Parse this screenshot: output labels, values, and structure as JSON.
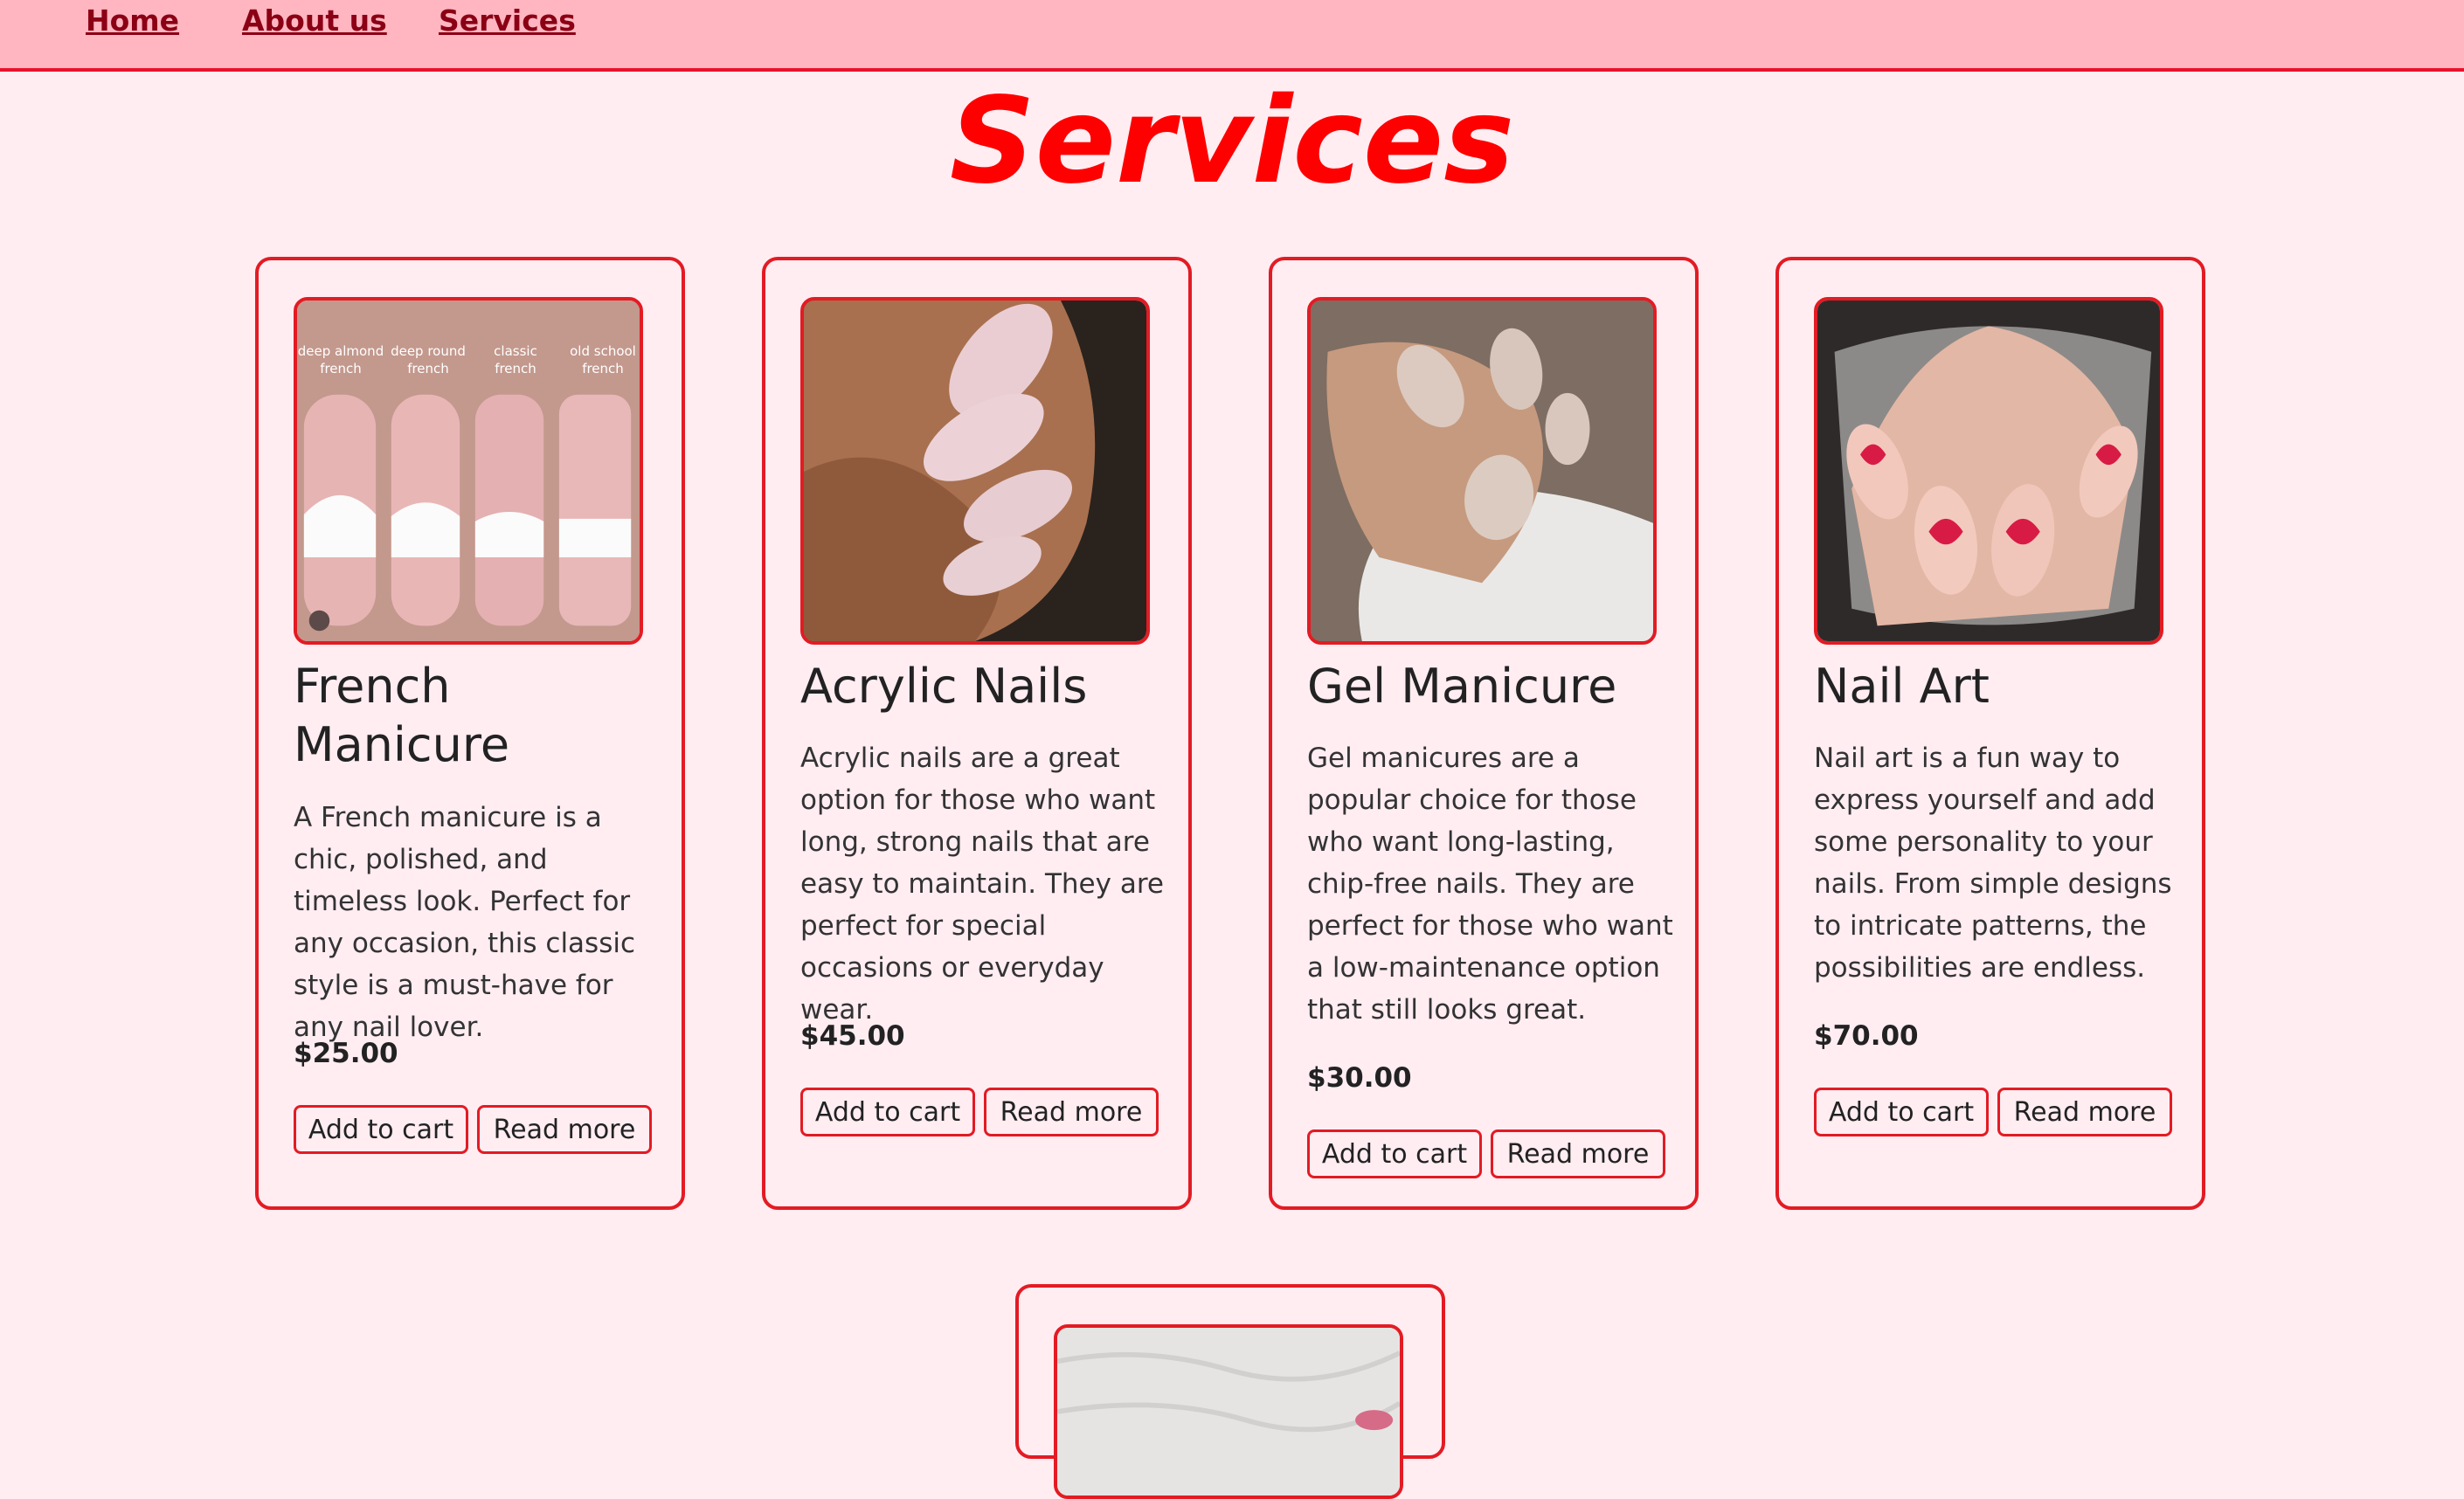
{
  "nav": {
    "home": "Home",
    "about": "About us",
    "services": "Services"
  },
  "page_title": "Services",
  "cards": [
    {
      "title": "French Manicure",
      "description": "A French manicure is a chic, polished, and timeless look. Perfect for any occasion, this classic style is a must-have for any nail lover.",
      "price": "$25.00",
      "image_labels": [
        "deep almond french",
        "deep round french",
        "classic french",
        "old school french"
      ],
      "add_to_cart": "Add to cart",
      "read_more": "Read more"
    },
    {
      "title": "Acrylic Nails",
      "description": "Acrylic nails are a great option for those who want long, strong nails that are easy to maintain. They are perfect for special occasions or everyday wear.",
      "price": "$45.00",
      "add_to_cart": "Add to cart",
      "read_more": "Read more"
    },
    {
      "title": "Gel Manicure",
      "description": "Gel manicures are a popular choice for those who want long-lasting, chip-free nails. They are perfect for those who want a low-maintenance option that still looks great.",
      "price": "$30.00",
      "add_to_cart": "Add to cart",
      "read_more": "Read more"
    },
    {
      "title": "Nail Art",
      "description": "Nail art is a fun way to express yourself and add some personality to your nails. From simple designs to intricate patterns, the possibilities are endless.",
      "price": "$70.00",
      "add_to_cart": "Add to cart",
      "read_more": "Read more"
    }
  ],
  "colors": {
    "accent": "#e31b23",
    "title": "#ff0000",
    "nav_bg": "#ffb6c1",
    "page_bg": "#ffedf2",
    "nav_link": "#8b0014"
  }
}
